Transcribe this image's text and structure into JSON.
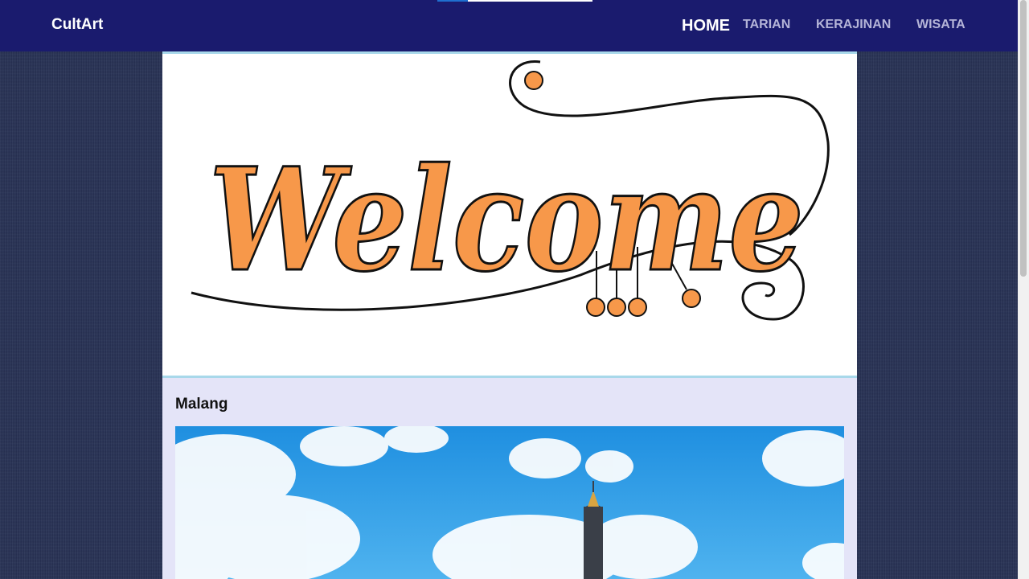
{
  "brand": "CultArt",
  "nav": {
    "home": "HOME",
    "tarian": "TARIAN",
    "kerajinan": "KERAJINAN",
    "wisata": "WISATA"
  },
  "banner": {
    "text": "Welcome",
    "accent_color": "#f7984a"
  },
  "section": {
    "title": "Malang"
  },
  "colors": {
    "navbar": "#1a1b6e",
    "banner_border": "#a8d8ea",
    "content_bg": "#e4e4f8",
    "sky": "#2e9ee8"
  }
}
